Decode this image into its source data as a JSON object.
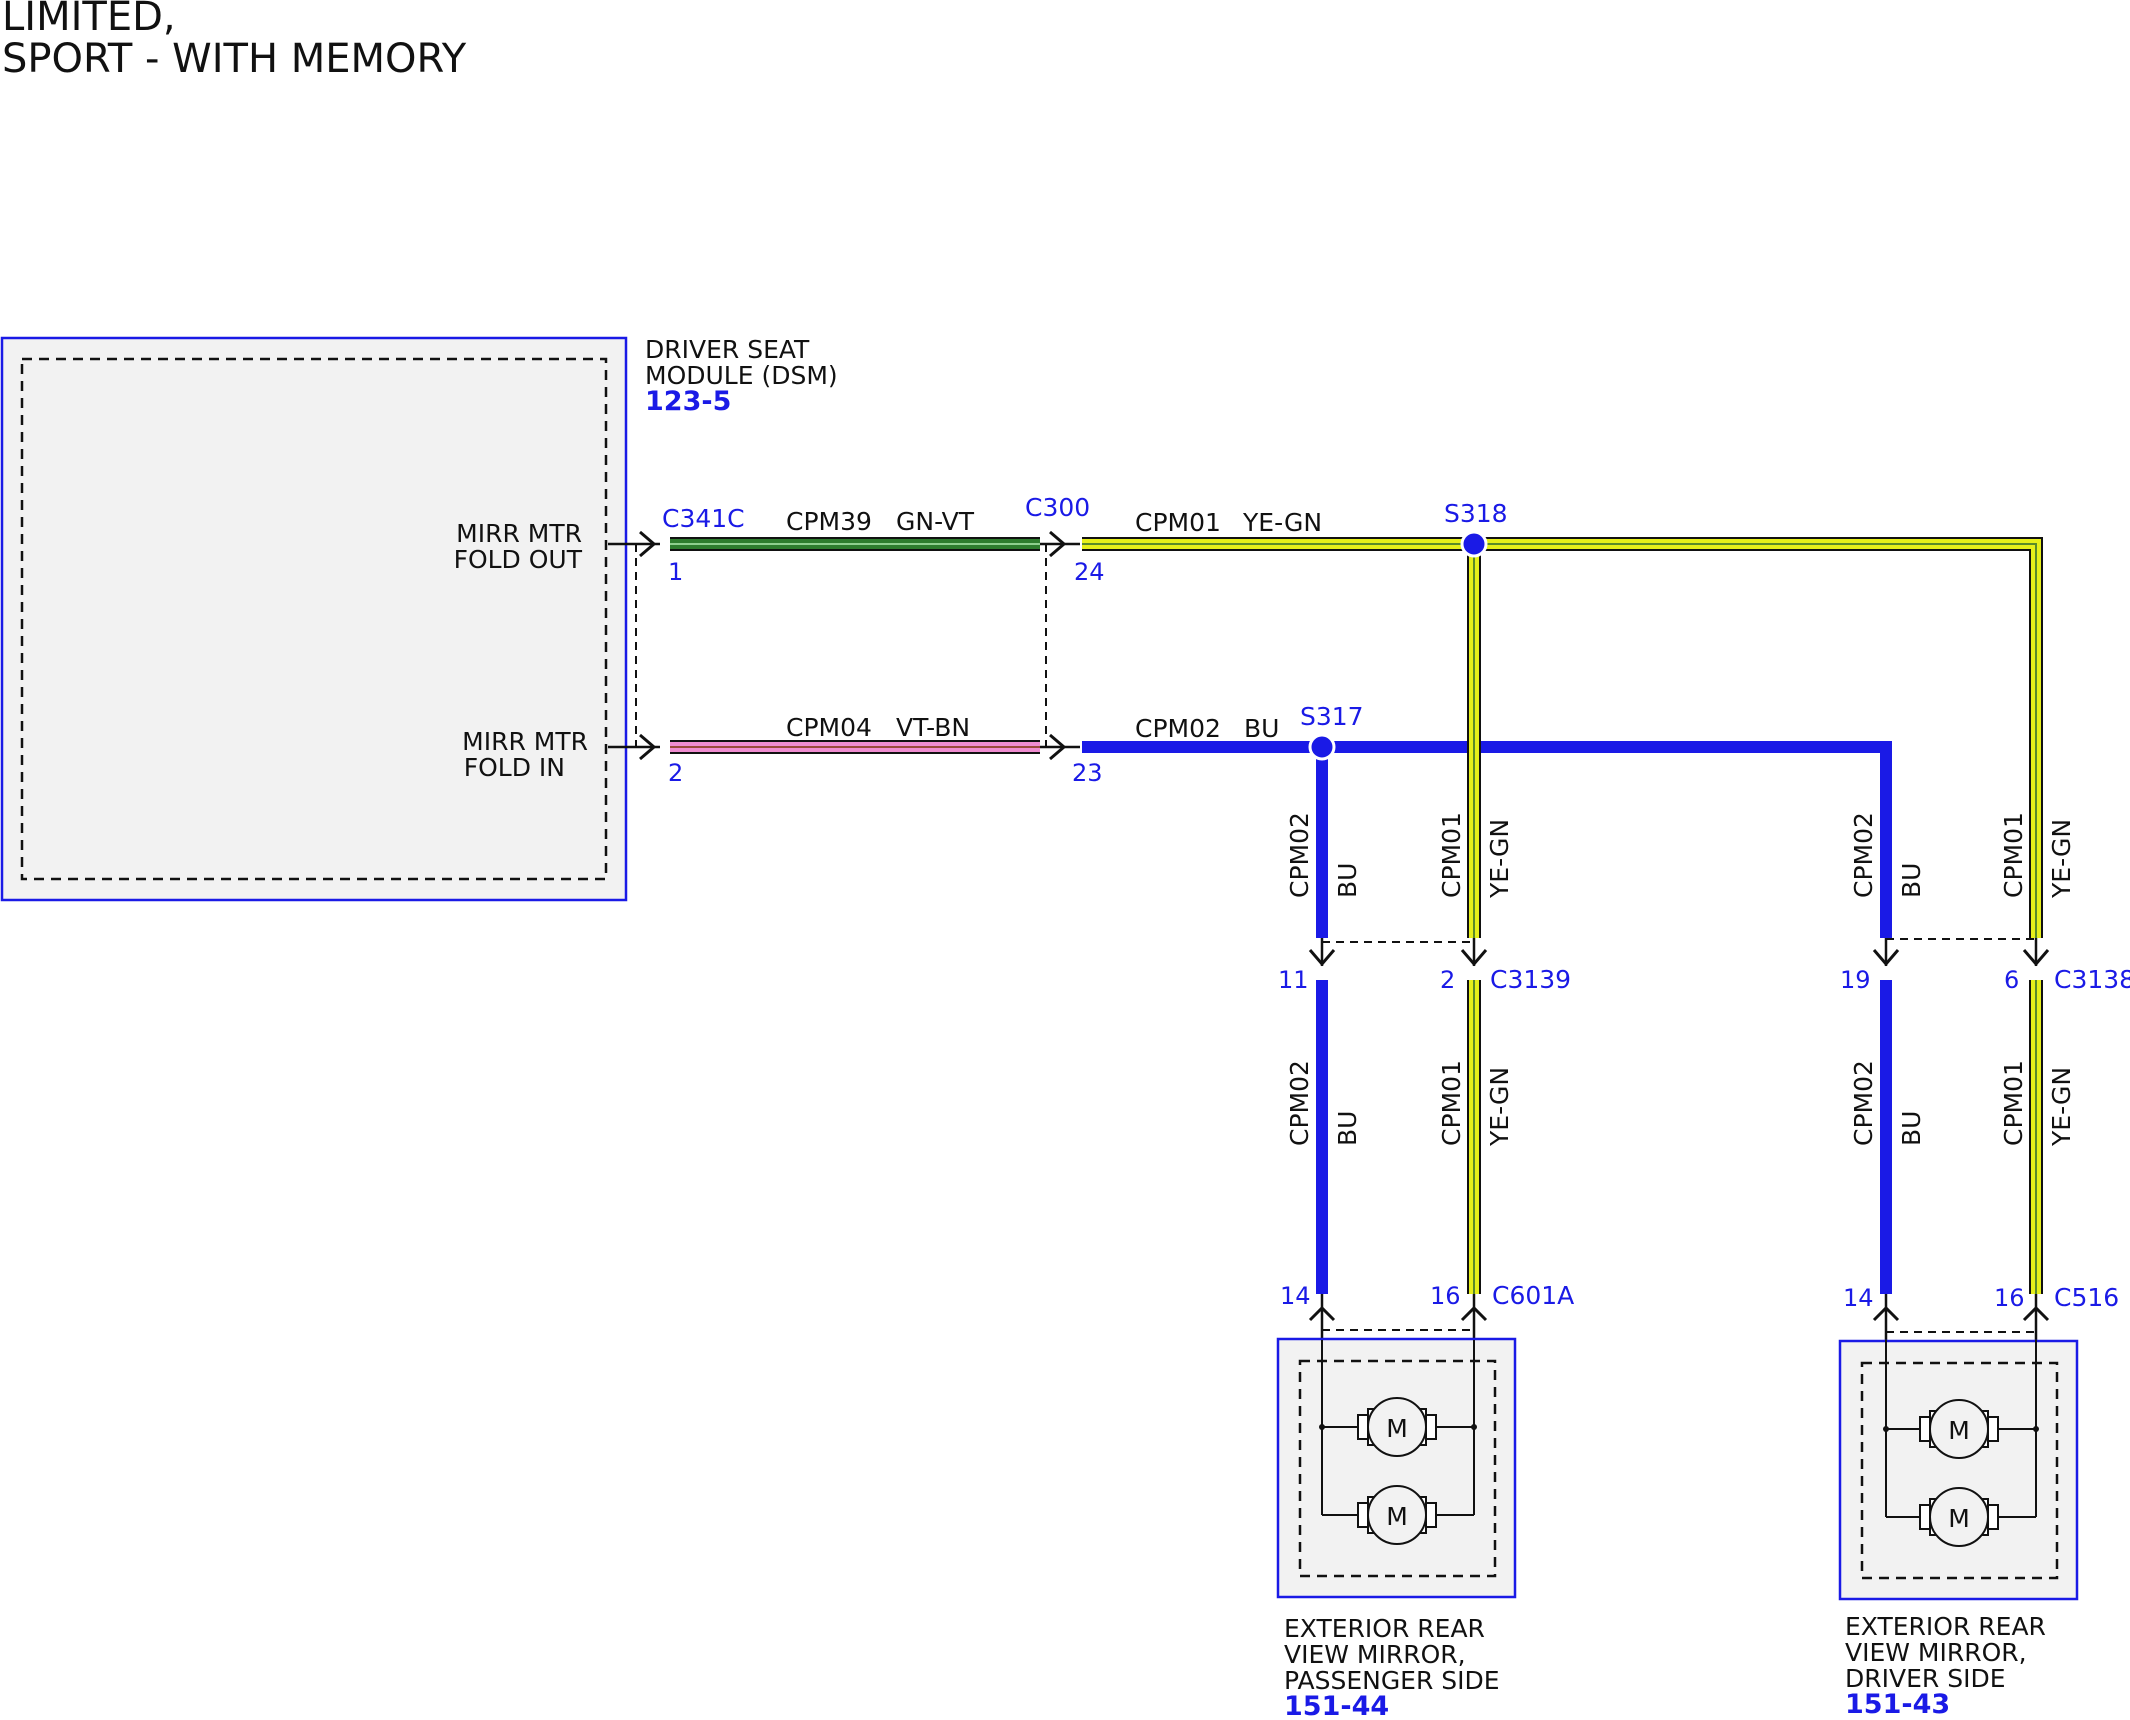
{
  "title": {
    "line1": "LIMITED,",
    "line2": "SPORT - WITH MEMORY"
  },
  "dsm": {
    "name_line1": "DRIVER SEAT",
    "name_line2": "MODULE (DSM)",
    "ref": "123-5",
    "pin_fold_out_line1": "MIRR MTR",
    "pin_fold_out_line2": "FOLD OUT",
    "pin_fold_in_line1": "MIRR MTR",
    "pin_fold_in_line2": "FOLD IN"
  },
  "connectors": {
    "c341c": {
      "name": "C341C",
      "pin_top": "1",
      "pin_bottom": "2"
    },
    "c300": {
      "name": "C300",
      "pin_top": "24",
      "pin_bottom": "23"
    },
    "c3139": {
      "name": "C3139",
      "pin_left": "11",
      "pin_right": "2"
    },
    "c3138": {
      "name": "C3138",
      "pin_left": "19",
      "pin_right": "6"
    },
    "c601a": {
      "name": "C601A",
      "pin_left": "14",
      "pin_right": "16"
    },
    "c516": {
      "name": "C516",
      "pin_left": "14",
      "pin_right": "16"
    }
  },
  "splices": {
    "s318": "S318",
    "s317": "S317"
  },
  "circuits": {
    "cpm39": {
      "id": "CPM39",
      "color": "GN-VT"
    },
    "cpm01": {
      "id": "CPM01",
      "color": "YE-GN"
    },
    "cpm04": {
      "id": "CPM04",
      "color": "VT-BN"
    },
    "cpm02": {
      "id": "CPM02",
      "color": "BU"
    }
  },
  "components": {
    "mirror_passenger": {
      "name_line1": "EXTERIOR REAR",
      "name_line2": "VIEW MIRROR,",
      "name_line3": "PASSENGER SIDE",
      "ref": "151-44"
    },
    "mirror_driver": {
      "name_line1": "EXTERIOR REAR",
      "name_line2": "VIEW MIRROR,",
      "name_line3": "DRIVER SIDE",
      "ref": "151-43"
    },
    "motor_symbol": "M"
  },
  "colors": {
    "gn_vt_wire": "#2e7d2e",
    "ye_gn_wire": "#e6ef1a",
    "vt_bn_wire": "#f08cd0",
    "bu_wire": "#1a1ae6",
    "component_border": "#1a1ae6",
    "component_fill": "#f2f2f2",
    "reference_text": "#1a1ae6"
  }
}
